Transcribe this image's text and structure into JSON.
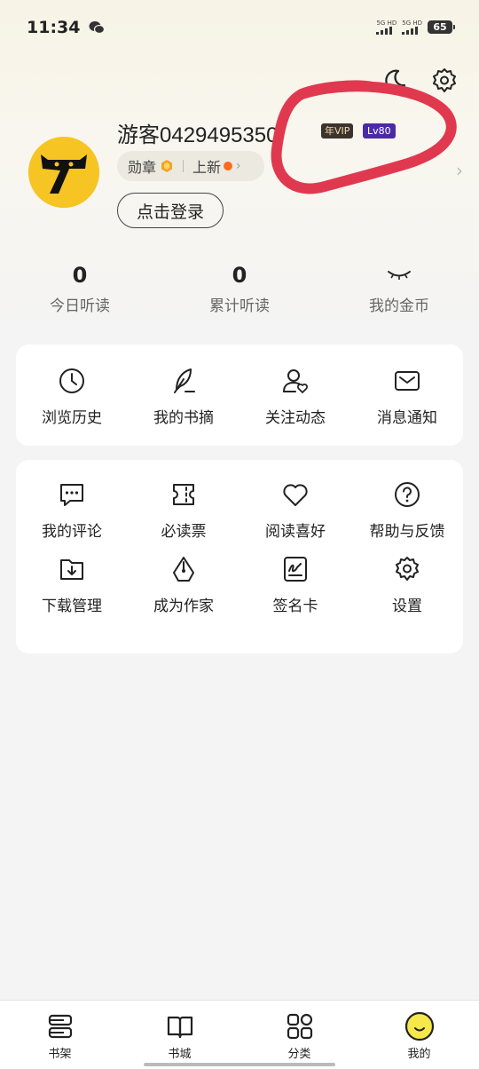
{
  "status_bar": {
    "time": "11:34",
    "signal1_label": "5G HD",
    "signal2_label": "5G HD",
    "battery": "65"
  },
  "header": {
    "icons": [
      "moon-icon",
      "settings-gear-icon"
    ]
  },
  "profile": {
    "username": "游客0429495350",
    "vip_badge": "年VIP",
    "level_badge": "Lv80",
    "medal_label": "勋章",
    "new_label": "上新",
    "login_button": "点击登录",
    "annotation_color": "#e0394f"
  },
  "stats": [
    {
      "value": "0",
      "label": "今日听读"
    },
    {
      "value": "0",
      "label": "累计听读"
    },
    {
      "value": "",
      "label": "我的金币"
    }
  ],
  "quick_menu": [
    {
      "label": "浏览历史",
      "icon": "clock-icon"
    },
    {
      "label": "我的书摘",
      "icon": "feather-icon"
    },
    {
      "label": "关注动态",
      "icon": "user-heart-icon"
    },
    {
      "label": "消息通知",
      "icon": "envelope-icon"
    }
  ],
  "services_menu": [
    {
      "label": "我的评论",
      "icon": "comment-icon"
    },
    {
      "label": "必读票",
      "icon": "ticket-icon"
    },
    {
      "label": "阅读喜好",
      "icon": "heart-icon"
    },
    {
      "label": "帮助与反馈",
      "icon": "help-icon"
    },
    {
      "label": "下载管理",
      "icon": "download-folder-icon"
    },
    {
      "label": "成为作家",
      "icon": "pen-nib-icon"
    },
    {
      "label": "签名卡",
      "icon": "signature-card-icon"
    },
    {
      "label": "设置",
      "icon": "settings-icon"
    }
  ],
  "bottom_nav": [
    {
      "label": "书架",
      "icon": "bookshelf-icon"
    },
    {
      "label": "书城",
      "icon": "open-book-icon"
    },
    {
      "label": "分类",
      "icon": "category-grid-icon"
    },
    {
      "label": "我的",
      "icon": "smiley-avatar-icon",
      "active": true
    }
  ],
  "colors": {
    "accent_yellow": "#f6c423",
    "level_purple": "#4c2aa6",
    "dot_orange": "#ff6a1a"
  }
}
